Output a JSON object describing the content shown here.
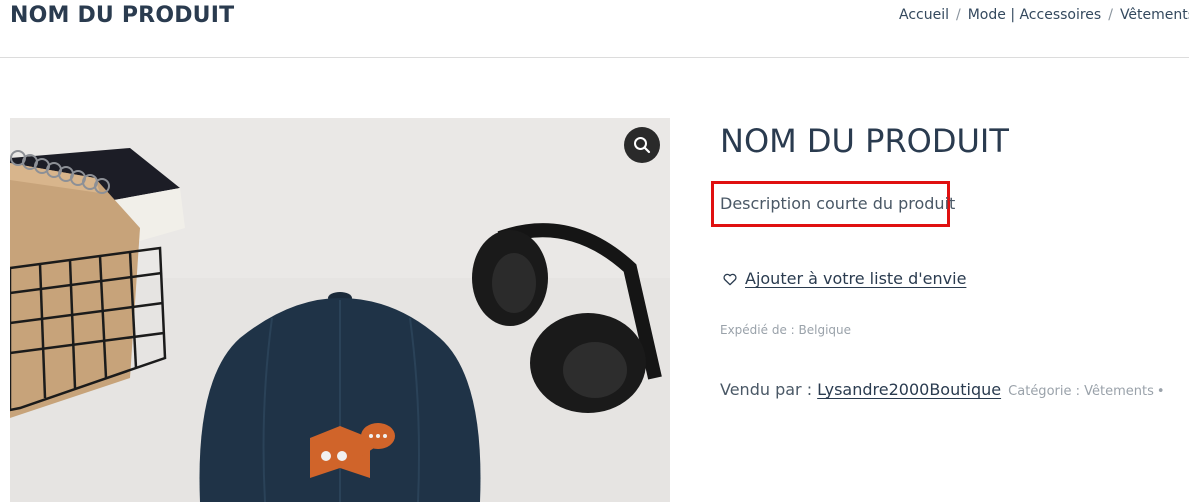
{
  "header": {
    "page_title": "NOM DU PRODUIT",
    "breadcrumb": [
      "Accueil",
      "Mode | Accessoires",
      "Vêtements"
    ]
  },
  "product_image": {
    "alt_logo_text": "oo"
  },
  "icons": {
    "zoom": "search-icon",
    "wishlist": "heart-icon"
  },
  "product": {
    "title": "NOM DU PRODUIT",
    "short_description": "Description courte du produit",
    "wishlist_label": "Ajouter à votre liste d'envie",
    "shipped_from": "Expédié de : Belgique",
    "sold_by_prefix": "Vendu par : ",
    "vendor": "Lysandre2000Boutique",
    "category": "Catégorie : Vêtements",
    "category_sep": "•"
  },
  "colors": {
    "highlight_border": "#e01010",
    "text_dark": "#2a3b4f",
    "text_muted": "#9aa2aa"
  }
}
